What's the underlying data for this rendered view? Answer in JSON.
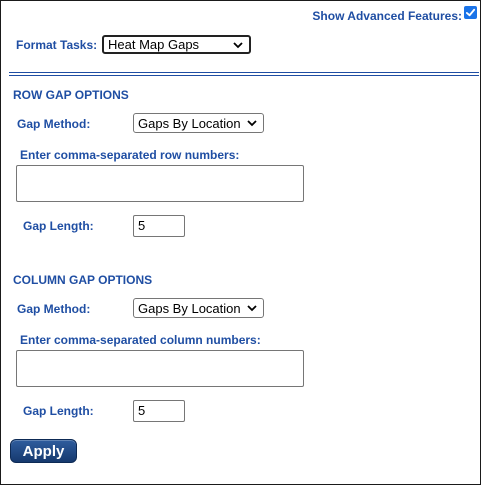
{
  "header": {
    "advanced_label": "Show Advanced Features:",
    "advanced_checked": true
  },
  "format_tasks": {
    "label": "Format Tasks:",
    "selected": "Heat Map Gaps"
  },
  "row_section": {
    "title": "ROW GAP OPTIONS",
    "gap_method_label": "Gap Method:",
    "gap_method_value": "Gaps By Location",
    "numbers_label": "Enter comma-separated row numbers:",
    "numbers_value": "",
    "gap_length_label": "Gap Length:",
    "gap_length_value": "5"
  },
  "column_section": {
    "title": "COLUMN GAP OPTIONS",
    "gap_method_label": "Gap Method:",
    "gap_method_value": "Gaps By Location",
    "numbers_label": "Enter comma-separated column numbers:",
    "numbers_value": "",
    "gap_length_label": "Gap Length:",
    "gap_length_value": "5"
  },
  "actions": {
    "apply_label": "Apply"
  },
  "colors": {
    "label_blue": "#1f4ea3",
    "button_blue": "#1c427d",
    "checkbox_blue": "#1a73e8"
  },
  "icons": {
    "checkbox": "check-icon",
    "dropdown": "chevron-down-icon"
  }
}
